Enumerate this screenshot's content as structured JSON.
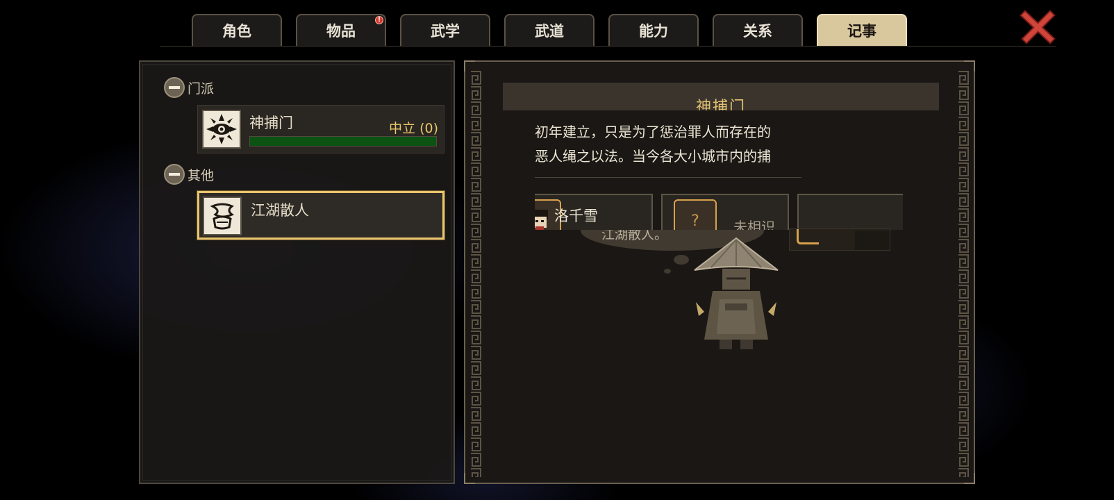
{
  "tabs": [
    {
      "label": "角色",
      "active": false,
      "badge": ""
    },
    {
      "label": "物品",
      "active": false,
      "badge": "!"
    },
    {
      "label": "武学",
      "active": false,
      "badge": ""
    },
    {
      "label": "武道",
      "active": false,
      "badge": ""
    },
    {
      "label": "能力",
      "active": false,
      "badge": ""
    },
    {
      "label": "关系",
      "active": false,
      "badge": ""
    },
    {
      "label": "记事",
      "active": true,
      "badge": ""
    }
  ],
  "close_icon": "close-x-icon",
  "colors": {
    "accent_gold": "#e8c56e",
    "tab_active_bg": "#d9c79d",
    "rep_bar_fill": "#0c5212",
    "close_red": "#d0443a",
    "badge_red": "#d93a32"
  },
  "sidebar": {
    "categories": [
      {
        "label": "门派",
        "expanded": true,
        "factions": [
          {
            "name": "神捕门",
            "status": "中立 (0)",
            "icon": "emblem-icon",
            "reputation_fraction": 1.0
          }
        ]
      },
      {
        "label": "其他",
        "expanded": true,
        "factions": [
          {
            "name": "江湖散人",
            "status": "",
            "icon": "scroll-emblem-icon",
            "selected": true
          }
        ]
      }
    ]
  },
  "detail": {
    "title": "神捕门",
    "description": [
      "初年建立，只是为了惩治罪人而存在的",
      "恶人绳之以法。当今各大小城市内的捕"
    ],
    "members": [
      {
        "name": "洛千雪",
        "avatar": "portrait-icon"
      },
      {
        "name": "未相识",
        "avatar": "unknown-portrait-icon",
        "avatar_glyph": "?"
      }
    ],
    "bubble_text": "江湖散人。",
    "character": "straw-hat-wanderer-sprite"
  }
}
